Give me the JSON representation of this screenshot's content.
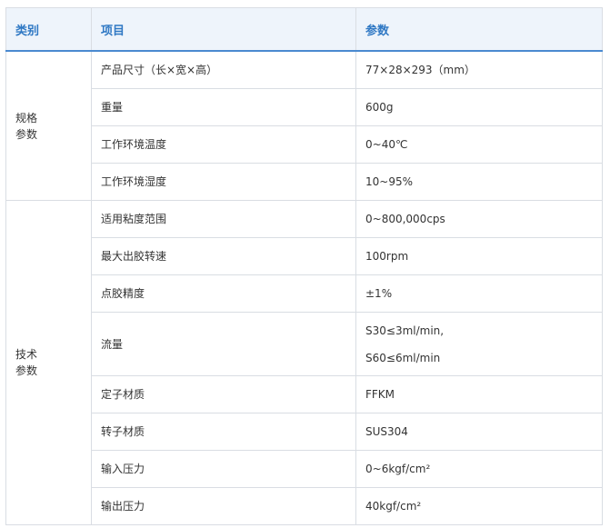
{
  "header": {
    "col1": "类别",
    "col2": "项目",
    "col3": "参数"
  },
  "groups": [
    {
      "category_line1": "规格",
      "category_line2": "参数",
      "rows": [
        {
          "item": "产品尺寸（长×宽×高）",
          "value": "77×28×293（mm）"
        },
        {
          "item": "重量",
          "value": "600g"
        },
        {
          "item": "工作环境温度",
          "value": "0~40℃"
        },
        {
          "item": "工作环境湿度",
          "value": "10~95%"
        }
      ]
    },
    {
      "category_line1": "技术",
      "category_line2": "参数",
      "rows": [
        {
          "item": "适用粘度范围",
          "value": "0~800,000cps"
        },
        {
          "item": "最大出胶转速",
          "value": "100rpm"
        },
        {
          "item": "点胶精度",
          "value": "±1%"
        },
        {
          "item": "流量",
          "value_line1": "S30≤3ml/min,",
          "value_line2": "S60≤6ml/min"
        },
        {
          "item": "定子材质",
          "value": "FFKM"
        },
        {
          "item": "转子材质",
          "value": "SUS304"
        },
        {
          "item": "输入压力",
          "value": "0~6kgf/cm²"
        },
        {
          "item": "输出压力",
          "value": "40kgf/cm²"
        }
      ]
    }
  ]
}
